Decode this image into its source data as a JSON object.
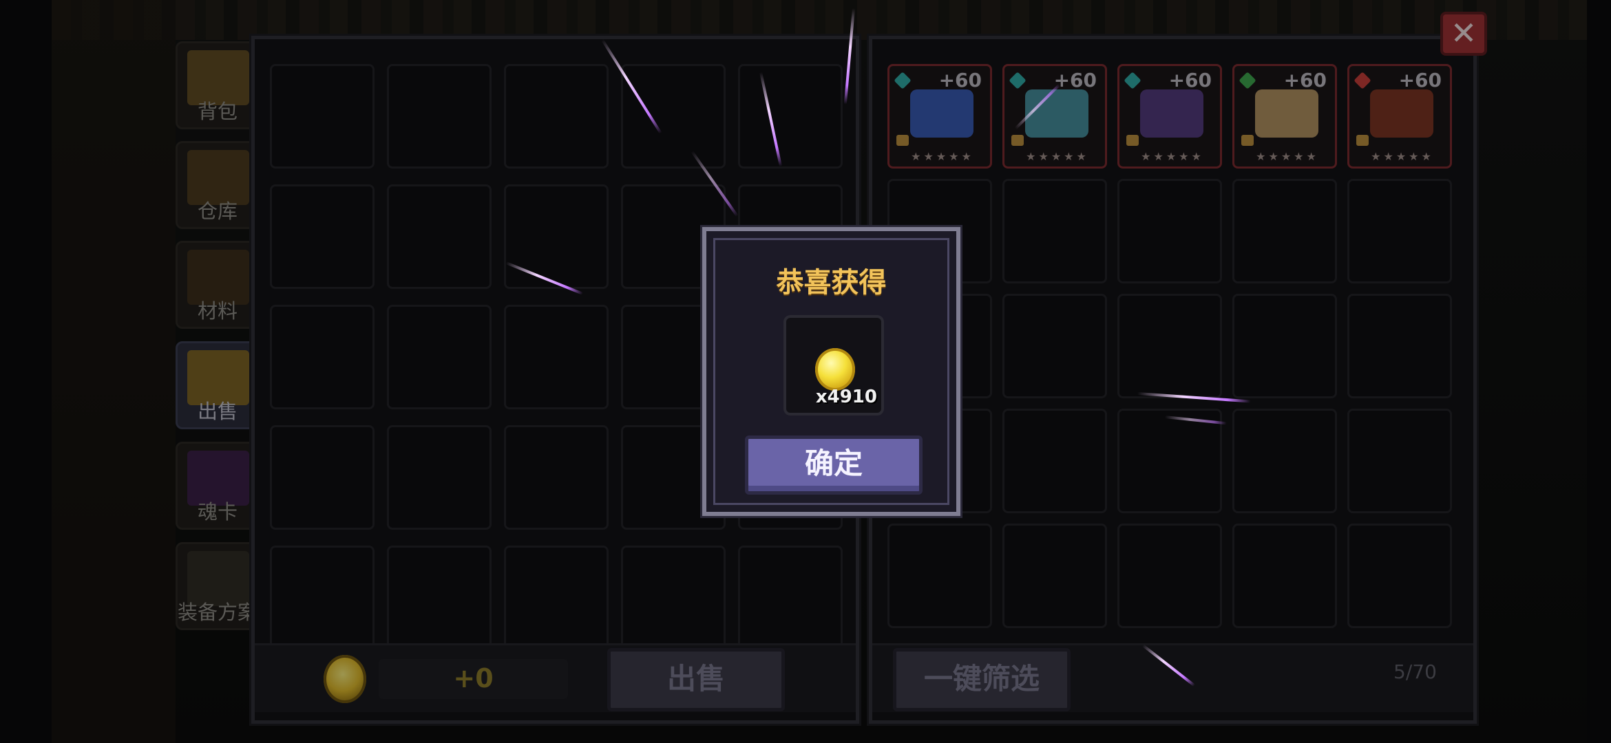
{
  "side_tabs": [
    {
      "label": "背包",
      "name": "backpack"
    },
    {
      "label": "仓库",
      "name": "warehouse"
    },
    {
      "label": "材料",
      "name": "materials"
    },
    {
      "label": "出售",
      "name": "sell"
    },
    {
      "label": "魂卡",
      "name": "soul-card"
    },
    {
      "label": "装备方案",
      "name": "equipment-plan"
    }
  ],
  "sell_panel": {
    "coin_total": "+0",
    "sell_button": "出售"
  },
  "inventory_panel": {
    "items": [
      {
        "bonus": "+60",
        "gem_color": "#2fa7a1",
        "art_color": "#3d64c9",
        "stars": "★★★★★"
      },
      {
        "bonus": "+60",
        "gem_color": "#2fa7a1",
        "art_color": "#4c9fb0",
        "stars": "★★★★★"
      },
      {
        "bonus": "+60",
        "gem_color": "#2fa7a1",
        "art_color": "#5a3f8c",
        "stars": "★★★★★"
      },
      {
        "bonus": "+60",
        "gem_color": "#3da24c",
        "art_color": "#c7a36b",
        "stars": "★★★★★"
      },
      {
        "bonus": "+60",
        "gem_color": "#c23c38",
        "art_color": "#8a3a25",
        "stars": "★★★★★"
      }
    ],
    "filter_button": "一键筛选",
    "page_count": "5/70"
  },
  "modal": {
    "title": "恭喜获得",
    "reward_count": "x4910",
    "confirm_button": "确定"
  },
  "close_label": "✕"
}
